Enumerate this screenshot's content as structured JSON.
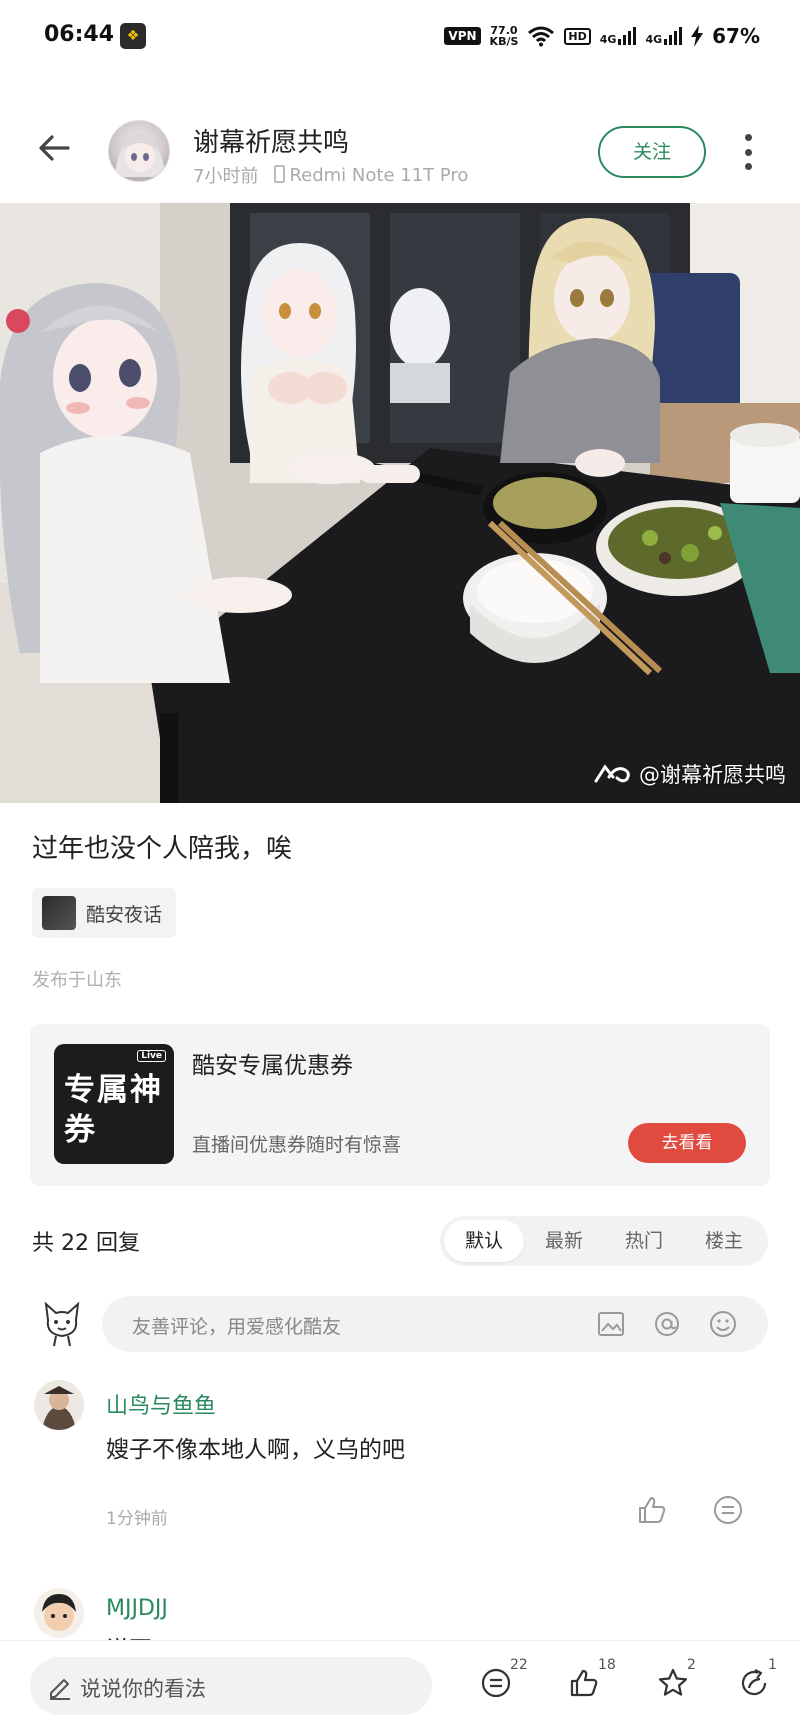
{
  "status_bar": {
    "time": "06:44",
    "vpn": "VPN",
    "speed_value": "77.0",
    "speed_unit": "KB/S",
    "hd": "HD",
    "net1": "4G",
    "net2": "4G",
    "battery": "67%"
  },
  "header": {
    "author_name": "谢幕祈愿共鸣",
    "time_ago": "7小时前",
    "device": "Redmi Note 11T Pro",
    "follow_label": "关注"
  },
  "photo": {
    "watermark": "@谢幕祈愿共鸣"
  },
  "post": {
    "text": "过年也没个人陪我，唉",
    "topic": "酷安夜话",
    "location": "发布于山东"
  },
  "ad": {
    "thumb_badge": "Live",
    "thumb_text": "专属神券",
    "title": "酷安专属优惠券",
    "subtitle": "直播间优惠券随时有惊喜",
    "button": "去看看"
  },
  "replies": {
    "count_label": "共 22 回复",
    "sort_tabs": [
      "默认",
      "最新",
      "热门",
      "楼主"
    ],
    "active_tab": "默认",
    "input_placeholder": "友善评论，用爱感化酷友"
  },
  "comments": [
    {
      "name": "山鸟与鱼鱼",
      "text": "嫂子不像本地人啊，义乌的吧",
      "time": "1分钟前"
    },
    {
      "name": "MJJDJJ",
      "text": "说不"
    }
  ],
  "bottom_bar": {
    "placeholder": "说说你的看法",
    "reply_count": "22",
    "like_count": "18",
    "star_count": "2",
    "share_count": "1"
  },
  "colors": {
    "accent_green": "#2a8a5e",
    "ad_button": "#e04a3f"
  }
}
